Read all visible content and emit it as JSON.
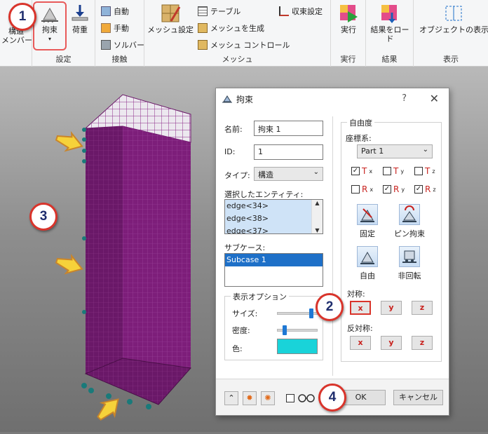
{
  "colors": {
    "mesh": "#7d1e7a",
    "mesh_edge": "#b35ab0",
    "accent": "#1e70c8",
    "callout_border": "#d9342b",
    "arrow": "#f6d23a",
    "swatch": "#19d3d9"
  },
  "ribbon": {
    "build_member_label": "構造\nメンバー",
    "settings": {
      "group_label": "設定",
      "constraint_label": "拘束",
      "load_label": "荷重"
    },
    "contact": {
      "group_label": "接触",
      "items": [
        "自動",
        "手動",
        "ソルバー"
      ]
    },
    "mesh": {
      "group_label": "メッシュ",
      "mesh_settings_label": "メッシュ設定",
      "items": [
        "テーブル",
        "メッシュを生成",
        "メッシュ コントロール"
      ],
      "convergence_label": "収束設定"
    },
    "run": {
      "group_label": "実行",
      "label": "実行"
    },
    "results": {
      "group_label": "結果",
      "label": "結果をロード"
    },
    "display": {
      "group_label": "表示",
      "label": "オブジェクトの表示/非"
    }
  },
  "dialog": {
    "title": "拘束",
    "help": "?",
    "close": "✕",
    "name_label": "名前:",
    "name_value": "拘束 1",
    "id_label": "ID:",
    "id_value": "1",
    "type_label": "タイプ:",
    "type_value": "構造",
    "entities_label": "選択したエンティティ:",
    "entities": [
      "edge<34>",
      "edge<38>",
      "edge<37>"
    ],
    "subcase_label": "サブケース:",
    "subcases": [
      "Subcase 1"
    ],
    "display_options": {
      "legend": "表示オプション",
      "size_label": "サイズ:",
      "density_label": "密度:",
      "color_label": "色:",
      "size_level": 0.82,
      "density_level": 0.18
    },
    "dof": {
      "legend": "自由度",
      "coord_label": "座標系:",
      "coord_value": "Part 1",
      "translations": [
        {
          "label": "T",
          "sub": "x",
          "checked": true
        },
        {
          "label": "T",
          "sub": "y",
          "checked": false
        },
        {
          "label": "T",
          "sub": "z",
          "checked": false
        }
      ],
      "rotations": [
        {
          "label": "R",
          "sub": "x",
          "checked": false
        },
        {
          "label": "R",
          "sub": "y",
          "checked": true
        },
        {
          "label": "R",
          "sub": "z",
          "checked": true
        }
      ],
      "presets": [
        "固定",
        "ピン拘束",
        "自由",
        "非回転"
      ],
      "symmetry_label": "対称:",
      "antisymmetry_label": "反対称:",
      "axes": [
        "x",
        "y",
        "z"
      ]
    },
    "ok_label": "OK",
    "cancel_label": "キャンセル"
  },
  "callouts": [
    "1",
    "2",
    "3",
    "4"
  ]
}
